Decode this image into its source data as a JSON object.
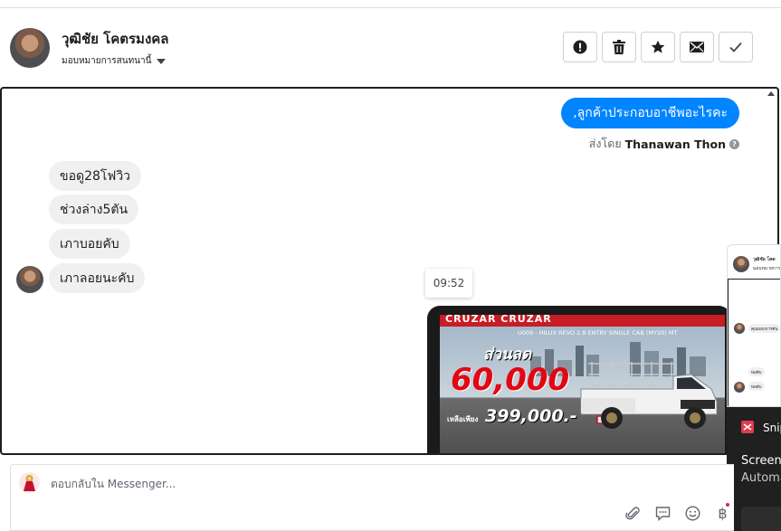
{
  "header": {
    "contact_name": "วุฒิชัย โคตรมงคล",
    "assign_label": "มอบหมายการสนทนานี้",
    "actions": [
      {
        "name": "mark-spam-button",
        "icon": "alert-circle-icon"
      },
      {
        "name": "delete-button",
        "icon": "trash-icon"
      },
      {
        "name": "star-button",
        "icon": "star-icon"
      },
      {
        "name": "mark-unread-button",
        "icon": "envelope-icon"
      },
      {
        "name": "mark-done-button",
        "icon": "check-icon"
      }
    ]
  },
  "chat": {
    "outgoing": {
      "text": ",ลูกค้าประกอบอาชีพอะไรคะ",
      "sent_by_prefix": "ส่งโดย",
      "sent_by_name": "Thanawan Thon",
      "help_icon": "?"
    },
    "incoming": [
      "ขอดู28โฟวิว",
      "ช่วงล่าง5ตัน",
      "เภาบอยคับ",
      "เภาลอยนะคับ"
    ],
    "timestamp": "09:52",
    "image": {
      "top_text": "CRUZAR CRUZAR",
      "model_text": "U009 - HILUX REVO 2.8 ENTRY SINGLE CAB (MY20) MT",
      "discount_label": "ส่วนลด",
      "discount_value": "60,000",
      "price_label": "เหลือเพียง",
      "price_value": "399,000.-"
    }
  },
  "overlay": {
    "card_name": "วุฒิชัย โคต",
    "card_sub": "มอบหมายการ",
    "bubbles": [
      "คุณมอบการคัน",
      "พ่อคับ",
      "พ่อคับ"
    ],
    "snip_title": "Snip",
    "snip_line1": "Screens",
    "snip_line2": "Automa"
  },
  "composer": {
    "placeholder": "ตอบกลับใน Messenger...",
    "tools": [
      "paperclip-icon",
      "speech-bubble-icon",
      "smiley-icon",
      "baht-icon"
    ],
    "baht_symbol": "฿"
  },
  "colors": {
    "accent": "#0084ff",
    "incoming_bubble": "#f1f0f0",
    "border": "#dddfe2"
  }
}
